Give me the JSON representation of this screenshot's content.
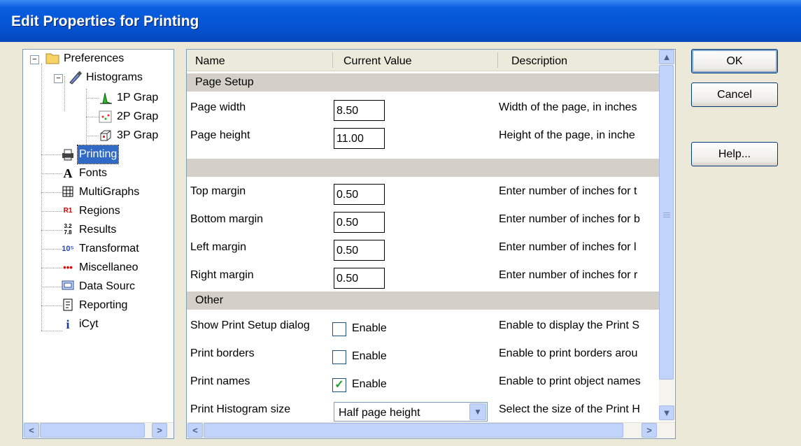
{
  "window": {
    "title": "Edit Properties for Printing"
  },
  "tree": {
    "items": [
      {
        "label": "Preferences",
        "icon": "folder-icon",
        "expander": "−"
      },
      {
        "label": "Histograms",
        "icon": "histogram-brush-icon",
        "expander": "−"
      },
      {
        "label": "1P Grap",
        "icon": "1p-graph-icon"
      },
      {
        "label": "2P Grap",
        "icon": "2p-graph-icon"
      },
      {
        "label": "3P Grap",
        "icon": "3p-graph-icon"
      },
      {
        "label": "Printing",
        "icon": "printer-icon",
        "selected": true
      },
      {
        "label": "Fonts",
        "icon": "fonts-icon",
        "glyph": "A"
      },
      {
        "label": "MultiGraphs",
        "icon": "multigraphs-icon"
      },
      {
        "label": "Regions",
        "icon": "regions-icon",
        "glyph": "R1"
      },
      {
        "label": "Results",
        "icon": "results-icon",
        "glyph": "3.2 7.8"
      },
      {
        "label": "Transformat",
        "icon": "transformation-icon",
        "glyph": "10⁵"
      },
      {
        "label": "Miscellaneo",
        "icon": "miscellaneous-icon",
        "glyph": "•••"
      },
      {
        "label": "Data Sourc",
        "icon": "data-source-icon"
      },
      {
        "label": "Reporting",
        "icon": "reporting-icon"
      },
      {
        "label": "iCyt",
        "icon": "icyt-icon",
        "glyph": "i"
      }
    ]
  },
  "grid": {
    "columns": [
      "Name",
      "Current Value",
      "Description"
    ],
    "sections": {
      "page_setup": "Page Setup",
      "other": "Other"
    },
    "rows": {
      "page_width": {
        "name": "Page width",
        "value": "8.50",
        "desc": "Width of the page, in inches"
      },
      "page_height": {
        "name": "Page height",
        "value": "11.00",
        "desc": "Height of the page, in inche"
      },
      "top_margin": {
        "name": "Top margin",
        "value": "0.50",
        "desc": "Enter number of inches for t"
      },
      "bottom_margin": {
        "name": "Bottom margin",
        "value": "0.50",
        "desc": "Enter number of inches for b"
      },
      "left_margin": {
        "name": "Left margin",
        "value": "0.50",
        "desc": "Enter number of inches for l"
      },
      "right_margin": {
        "name": "Right margin",
        "value": "0.50",
        "desc": "Enter number of inches for r"
      },
      "show_print_setup": {
        "name": "Show Print Setup dialog",
        "check_label": "Enable",
        "checked": false,
        "desc": "Enable to display the Print S"
      },
      "print_borders": {
        "name": "Print borders",
        "check_label": "Enable",
        "checked": false,
        "desc": "Enable to print borders arou"
      },
      "print_names": {
        "name": "Print names",
        "check_label": "Enable",
        "checked": true,
        "check_mark": "✓",
        "desc": "Enable to print object names"
      },
      "print_histogram_size": {
        "name": "Print Histogram size",
        "value": "Half page height",
        "desc": "Select the size of the Print H"
      }
    }
  },
  "buttons": {
    "ok": "OK",
    "cancel": "Cancel",
    "help": "Help..."
  },
  "colors": {
    "title_bar": "#0554d4",
    "selection": "#316ac5",
    "section_bg": "#d4d0c8",
    "check": "#21a121"
  }
}
